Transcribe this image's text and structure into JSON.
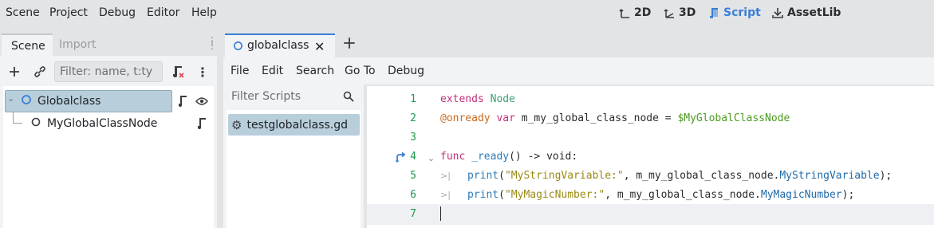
{
  "menubar": {
    "items": [
      "Scene",
      "Project",
      "Debug",
      "Editor",
      "Help"
    ]
  },
  "workspaces": [
    {
      "label": "2D",
      "icon": "2d-viewport-icon",
      "active": false
    },
    {
      "label": "3D",
      "icon": "3d-viewport-icon",
      "active": false
    },
    {
      "label": "Script",
      "icon": "script-icon",
      "active": true
    },
    {
      "label": "AssetLib",
      "icon": "download-icon",
      "active": false
    }
  ],
  "scene_dock": {
    "tabs": [
      {
        "label": "Scene",
        "active": true
      },
      {
        "label": "Import",
        "active": false
      }
    ],
    "filter_placeholder": "Filter: name, t:ty",
    "tree": [
      {
        "label": "Globalclass",
        "selected": true,
        "has_script": true,
        "visible_toggle": true
      },
      {
        "label": "MyGlobalClassNode",
        "selected": false,
        "has_script": true
      }
    ]
  },
  "script_editor": {
    "open_tab": "globalclass",
    "menus": [
      "File",
      "Edit",
      "Search",
      "Go To",
      "Debug"
    ],
    "filter_placeholder": "Filter Scripts",
    "scripts": [
      "testglobalclass.gd"
    ],
    "line_numbers": [
      "1",
      "2",
      "3",
      "4",
      "5",
      "6",
      "7"
    ],
    "code": {
      "l1": {
        "kw": "extends",
        "type": "Node"
      },
      "l2": {
        "anno": "@onready",
        "kw": "var",
        "name": "m_my_global_class_node",
        "op": "=",
        "path": "$MyGlobalClassNode"
      },
      "l4": {
        "kw": "func",
        "fn": "_ready",
        "sig": "()",
        "arrow": "->",
        "ret": "void:"
      },
      "l5": {
        "fn": "print",
        "str": "\"MyStringVariable:\"",
        "obj": "m_my_global_class_node.",
        "member": "MyStringVariable",
        "tail": ");"
      },
      "l6": {
        "fn": "print",
        "str": "\"MyMagicNumber:\"",
        "obj": "m_my_global_class_node.",
        "member": "MyMagicNumber",
        "tail": ");"
      }
    },
    "current_line": "7"
  },
  "colors": {
    "accent": "#3a7fd6",
    "selection": "#b8cedb",
    "keyword": "#c2307a",
    "string": "#9a8a14",
    "line_number": "#1f9a4e"
  }
}
